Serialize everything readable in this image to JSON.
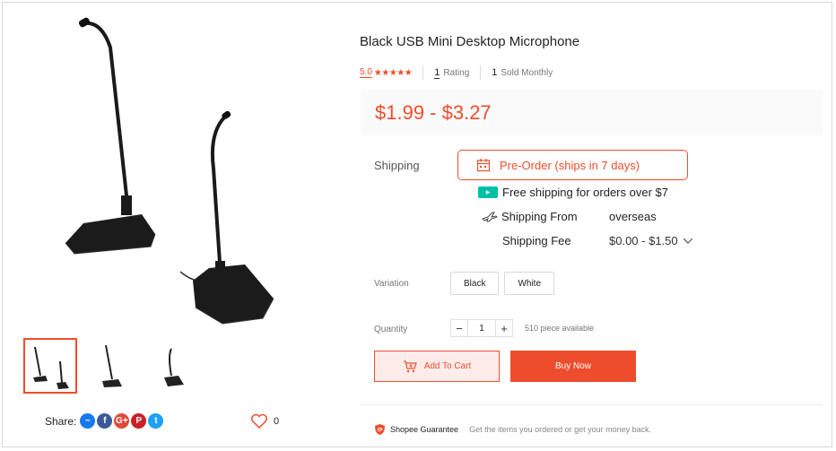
{
  "product": {
    "title": "Black USB Mini Desktop Microphone",
    "rating_score": "5.0",
    "stars": "★★★★★",
    "rating_count": "1",
    "rating_label": "Rating",
    "sold_count": "1",
    "sold_label": "Sold Monthly",
    "price": "$1.99 - $3.27"
  },
  "gallery": {
    "main_image_icon": "microphone-product-image",
    "thumbnails": [
      "two-microphones-thumbnail",
      "tall-microphone-thumbnail",
      "short-microphone-thumbnail"
    ]
  },
  "share": {
    "label": "Share:",
    "icons": [
      {
        "name": "messenger-icon",
        "glyph": "~",
        "color": "#1877f2"
      },
      {
        "name": "facebook-icon",
        "glyph": "f",
        "color": "#3b5998"
      },
      {
        "name": "google-plus-icon",
        "glyph": "G+",
        "color": "#dd4b39"
      },
      {
        "name": "pinterest-icon",
        "glyph": "P",
        "color": "#cb2027"
      },
      {
        "name": "twitter-icon",
        "glyph": "t",
        "color": "#1da1f2"
      }
    ],
    "like_count": "0"
  },
  "shipping": {
    "label": "Shipping",
    "preorder": "Pre-Order (ships in 7 days)",
    "free_shipping": "Free shipping for orders over $7",
    "from_label": "Shipping From",
    "from_value": "overseas",
    "fee_label": "Shipping Fee",
    "fee_value": "$0.00 - $1.50"
  },
  "variation": {
    "label": "Variation",
    "options": [
      "Black",
      "White"
    ]
  },
  "quantity": {
    "label": "Quantity",
    "minus": "−",
    "value": "1",
    "plus": "+",
    "available": "510 piece available"
  },
  "actions": {
    "add_to_cart": "Add To Cart",
    "buy_now": "Buy Now"
  },
  "guarantee": {
    "title": "Shopee Guarantee",
    "description": "Get the items you ordered or get your money back."
  },
  "colors": {
    "accent": "#ee4d2d",
    "free_shipping_badge": "#00bfa5"
  }
}
